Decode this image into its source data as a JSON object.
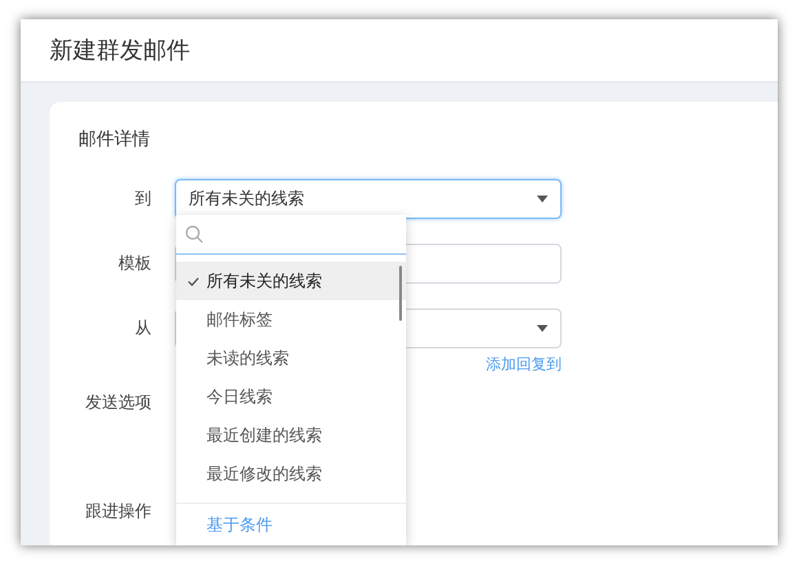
{
  "window": {
    "title": "新建群发邮件"
  },
  "card": {
    "title": "邮件详情"
  },
  "form": {
    "fields": [
      {
        "label": "到",
        "kind": "select",
        "value": "所有未关的线索",
        "focused": true
      },
      {
        "label": "模板",
        "kind": "input",
        "focused": false
      },
      {
        "label": "从",
        "kind": "select",
        "focused": false
      }
    ],
    "link": "添加回复到",
    "sections": [
      "发送选项",
      "跟进操作"
    ]
  },
  "dropdown": {
    "items": [
      {
        "label": "所有未关的线索",
        "selected": true
      },
      {
        "label": "邮件标签",
        "selected": false
      },
      {
        "label": "未读的线索",
        "selected": false
      },
      {
        "label": "今日线索",
        "selected": false
      },
      {
        "label": "最近创建的线索",
        "selected": false
      },
      {
        "label": "最近修改的线索",
        "selected": false
      }
    ],
    "footer": "基于条件"
  }
}
